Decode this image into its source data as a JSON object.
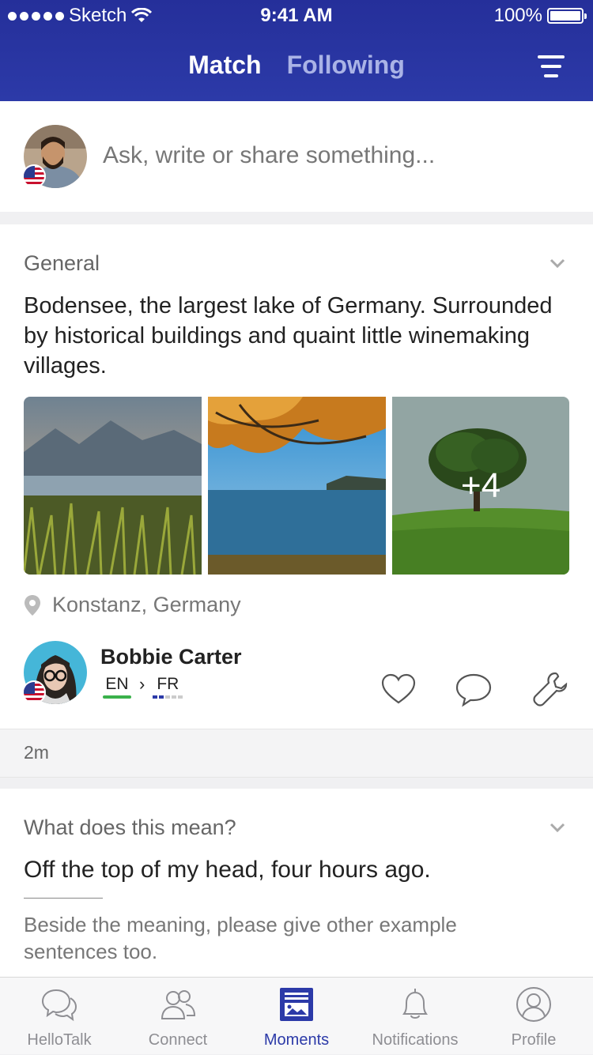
{
  "status_bar": {
    "carrier": "Sketch",
    "time": "9:41 AM",
    "battery": "100%"
  },
  "header": {
    "tabs": [
      "Match",
      "Following"
    ],
    "active_tab": "Match"
  },
  "compose": {
    "placeholder": "Ask, write or share something..."
  },
  "post1": {
    "category": "General",
    "text": "Bodensee, the largest lake of Germany. Surrounded by historical buildings and quaint little winemaking villages.",
    "more_photos": "+4",
    "location": "Konstanz, Germany",
    "author": {
      "name": "Bobbie Carter",
      "native": "EN",
      "learning": "FR"
    },
    "time_ago": "2m"
  },
  "post2": {
    "category": "What does this mean?",
    "text": "Off the top of my head, four hours ago.",
    "hint": "Beside the meaning, please give other example sentences too."
  },
  "tab_bar": {
    "items": [
      {
        "label": "HelloTalk",
        "icon": "chat-bubbles-icon"
      },
      {
        "label": "Connect",
        "icon": "people-icon"
      },
      {
        "label": "Moments",
        "icon": "moments-icon"
      },
      {
        "label": "Notifications",
        "icon": "bell-icon"
      },
      {
        "label": "Profile",
        "icon": "profile-icon"
      }
    ],
    "active": "Moments"
  },
  "colors": {
    "brand": "#2c3aa8",
    "native_bar": "#3ab14b"
  }
}
